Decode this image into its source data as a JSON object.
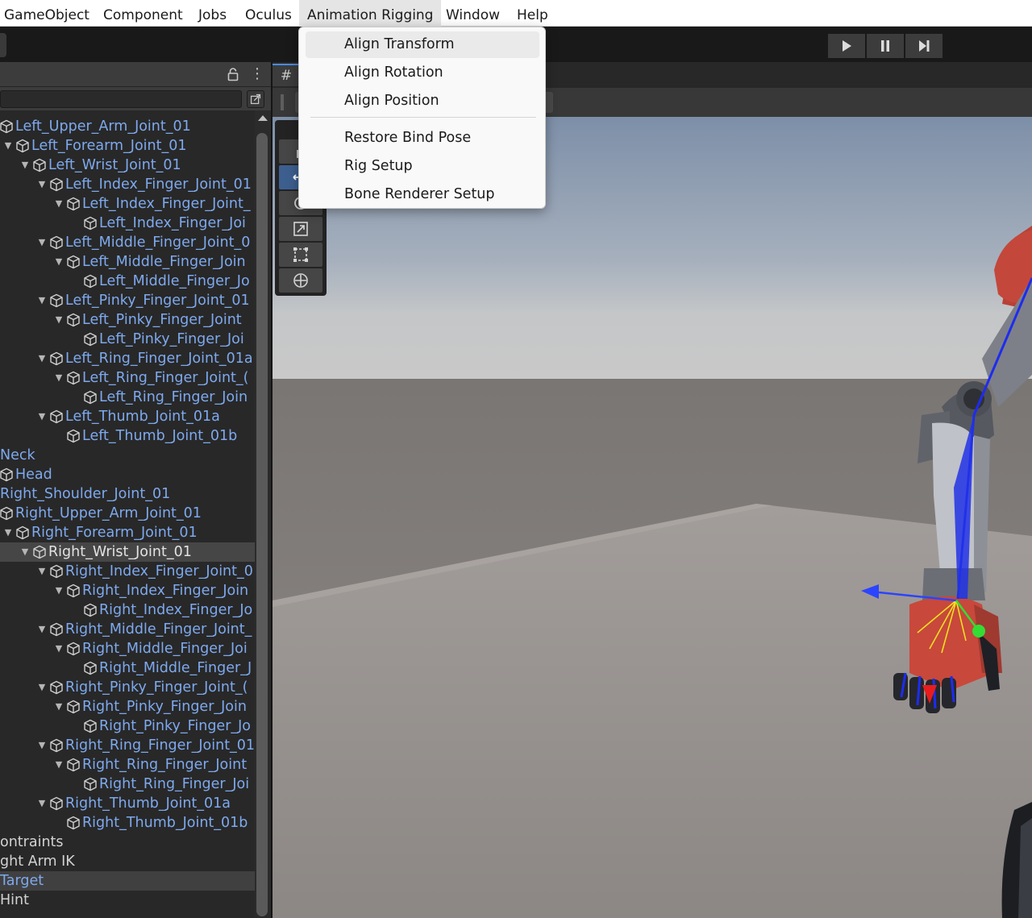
{
  "menubar": {
    "items": [
      "GameObject",
      "Component",
      "Jobs",
      "Oculus",
      "Animation Rigging",
      "Window",
      "Help"
    ],
    "active": "Animation Rigging"
  },
  "animation_rigging_menu": {
    "group1": [
      "Align Transform",
      "Align Rotation",
      "Align Position"
    ],
    "group2": [
      "Restore Bind Pose",
      "Rig Setup",
      "Bone Renderer Setup"
    ],
    "hovered": "Align Transform"
  },
  "scene": {
    "tab_glyph": "#"
  },
  "hierarchy": {
    "rows": [
      {
        "label": "Left_Upper_Arm_Joint_01",
        "depth": 0,
        "arrow": false,
        "cube": true,
        "style": "prefab"
      },
      {
        "label": "Left_Forearm_Joint_01",
        "depth": 1,
        "arrow": true,
        "cube": true,
        "style": "prefab"
      },
      {
        "label": "Left_Wrist_Joint_01",
        "depth": 2,
        "arrow": true,
        "cube": true,
        "style": "prefab"
      },
      {
        "label": "Left_Index_Finger_Joint_01",
        "depth": 3,
        "arrow": true,
        "cube": true,
        "style": "prefab"
      },
      {
        "label": "Left_Index_Finger_Joint_",
        "depth": 4,
        "arrow": true,
        "cube": true,
        "style": "prefab"
      },
      {
        "label": "Left_Index_Finger_Joi",
        "depth": 5,
        "arrow": false,
        "cube": true,
        "style": "prefab"
      },
      {
        "label": "Left_Middle_Finger_Joint_0",
        "depth": 3,
        "arrow": true,
        "cube": true,
        "style": "prefab"
      },
      {
        "label": "Left_Middle_Finger_Join",
        "depth": 4,
        "arrow": true,
        "cube": true,
        "style": "prefab"
      },
      {
        "label": "Left_Middle_Finger_Jo",
        "depth": 5,
        "arrow": false,
        "cube": true,
        "style": "prefab"
      },
      {
        "label": "Left_Pinky_Finger_Joint_01",
        "depth": 3,
        "arrow": true,
        "cube": true,
        "style": "prefab"
      },
      {
        "label": "Left_Pinky_Finger_Joint",
        "depth": 4,
        "arrow": true,
        "cube": true,
        "style": "prefab"
      },
      {
        "label": "Left_Pinky_Finger_Joi",
        "depth": 5,
        "arrow": false,
        "cube": true,
        "style": "prefab"
      },
      {
        "label": "Left_Ring_Finger_Joint_01a",
        "depth": 3,
        "arrow": true,
        "cube": true,
        "style": "prefab"
      },
      {
        "label": "Left_Ring_Finger_Joint_(",
        "depth": 4,
        "arrow": true,
        "cube": true,
        "style": "prefab"
      },
      {
        "label": "Left_Ring_Finger_Join",
        "depth": 5,
        "arrow": false,
        "cube": true,
        "style": "prefab"
      },
      {
        "label": "Left_Thumb_Joint_01a",
        "depth": 3,
        "arrow": true,
        "cube": true,
        "style": "prefab"
      },
      {
        "label": "Left_Thumb_Joint_01b",
        "depth": 4,
        "arrow": false,
        "cube": true,
        "style": "prefab"
      },
      {
        "label": "Neck",
        "depth": -1,
        "arrow": false,
        "cube": false,
        "style": "prefab"
      },
      {
        "label": "Head",
        "depth": 0,
        "arrow": false,
        "cube": true,
        "style": "prefab"
      },
      {
        "label": "Right_Shoulder_Joint_01",
        "depth": -1,
        "arrow": false,
        "cube": false,
        "style": "prefab"
      },
      {
        "label": "Right_Upper_Arm_Joint_01",
        "depth": 0,
        "arrow": false,
        "cube": true,
        "style": "prefab"
      },
      {
        "label": "Right_Forearm_Joint_01",
        "depth": 1,
        "arrow": true,
        "cube": true,
        "style": "prefab"
      },
      {
        "label": "Right_Wrist_Joint_01",
        "depth": 2,
        "arrow": true,
        "cube": true,
        "style": "selected"
      },
      {
        "label": "Right_Index_Finger_Joint_0",
        "depth": 3,
        "arrow": true,
        "cube": true,
        "style": "prefab"
      },
      {
        "label": "Right_Index_Finger_Join",
        "depth": 4,
        "arrow": true,
        "cube": true,
        "style": "prefab"
      },
      {
        "label": "Right_Index_Finger_Jo",
        "depth": 5,
        "arrow": false,
        "cube": true,
        "style": "prefab"
      },
      {
        "label": "Right_Middle_Finger_Joint_",
        "depth": 3,
        "arrow": true,
        "cube": true,
        "style": "prefab"
      },
      {
        "label": "Right_Middle_Finger_Joi",
        "depth": 4,
        "arrow": true,
        "cube": true,
        "style": "prefab"
      },
      {
        "label": "Right_Middle_Finger_J",
        "depth": 5,
        "arrow": false,
        "cube": true,
        "style": "prefab"
      },
      {
        "label": "Right_Pinky_Finger_Joint_(",
        "depth": 3,
        "arrow": true,
        "cube": true,
        "style": "prefab"
      },
      {
        "label": "Right_Pinky_Finger_Join",
        "depth": 4,
        "arrow": true,
        "cube": true,
        "style": "prefab"
      },
      {
        "label": "Right_Pinky_Finger_Jo",
        "depth": 5,
        "arrow": false,
        "cube": true,
        "style": "prefab"
      },
      {
        "label": "Right_Ring_Finger_Joint_01",
        "depth": 3,
        "arrow": true,
        "cube": true,
        "style": "prefab"
      },
      {
        "label": "Right_Ring_Finger_Joint",
        "depth": 4,
        "arrow": true,
        "cube": true,
        "style": "prefab"
      },
      {
        "label": "Right_Ring_Finger_Joi",
        "depth": 5,
        "arrow": false,
        "cube": true,
        "style": "prefab"
      },
      {
        "label": "Right_Thumb_Joint_01a",
        "depth": 3,
        "arrow": true,
        "cube": true,
        "style": "prefab"
      },
      {
        "label": "Right_Thumb_Joint_01b",
        "depth": 4,
        "arrow": false,
        "cube": true,
        "style": "prefab"
      },
      {
        "label": "ontraints",
        "depth": -1,
        "arrow": false,
        "cube": false,
        "style": "plain"
      },
      {
        "label": "ght Arm IK",
        "depth": -1,
        "arrow": false,
        "cube": false,
        "style": "plain"
      },
      {
        "label": "Target",
        "depth": -1,
        "arrow": false,
        "cube": false,
        "style": "target"
      },
      {
        "label": "Hint",
        "depth": -1,
        "arrow": false,
        "cube": false,
        "style": "plain"
      }
    ]
  },
  "colors": {
    "prefab_text": "#7ea9ee",
    "plain_text": "#d2d2d2",
    "accent": "#4a8be0"
  }
}
